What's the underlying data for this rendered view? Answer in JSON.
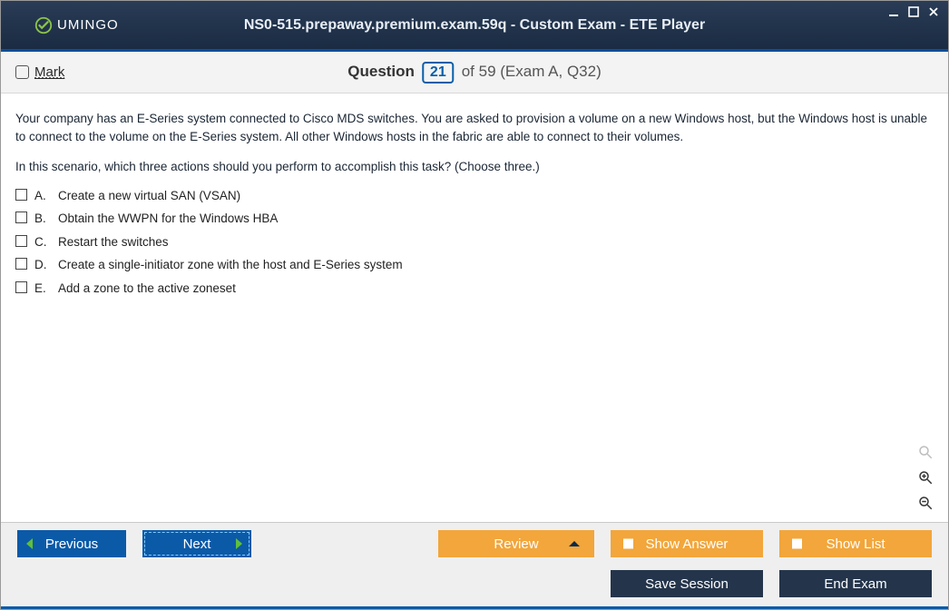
{
  "app": {
    "brand": "UMINGO",
    "title": "NS0-515.prepaway.premium.exam.59q - Custom Exam - ETE Player"
  },
  "header": {
    "mark_label": "Mark",
    "question_word": "Question",
    "current": "21",
    "of_total_context": "of 59 (Exam A, Q32)"
  },
  "question": {
    "text": "Your company has an E-Series system connected to Cisco MDS switches. You are asked to provision a volume on a new Windows host, but the Windows host is unable to connect to the volume on the E-Series system. All other Windows hosts in the fabric are able to connect to their volumes.",
    "prompt": "In this scenario, which three actions should you perform to accomplish this task? (Choose three.)",
    "options": [
      {
        "letter": "A.",
        "text": "Create a new virtual SAN (VSAN)"
      },
      {
        "letter": "B.",
        "text": "Obtain the WWPN for the Windows HBA"
      },
      {
        "letter": "C.",
        "text": "Restart the switches"
      },
      {
        "letter": "D.",
        "text": "Create a single-initiator zone with the host and E-Series system"
      },
      {
        "letter": "E.",
        "text": "Add a zone to the active zoneset"
      }
    ]
  },
  "footer": {
    "previous": "Previous",
    "next": "Next",
    "review": "Review",
    "show_answer": "Show Answer",
    "show_list": "Show List",
    "save_session": "Save Session",
    "end_exam": "End Exam"
  }
}
